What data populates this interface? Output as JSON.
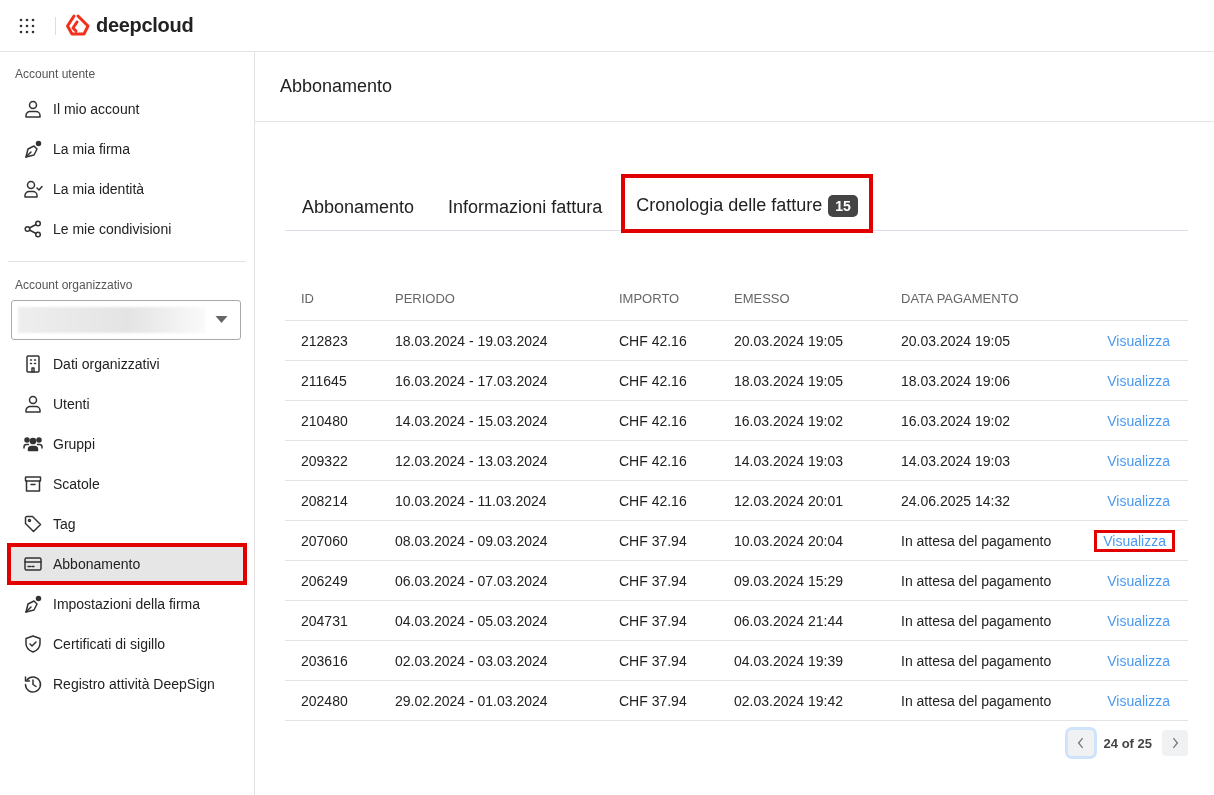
{
  "header": {
    "brand": "deepcloud"
  },
  "sidebar": {
    "sections": [
      {
        "label": "Account utente",
        "items": [
          {
            "label": "Il mio account",
            "selected": false,
            "highlighted": false
          },
          {
            "label": "La mia firma",
            "selected": false,
            "highlighted": false
          },
          {
            "label": "La mia identità",
            "selected": false,
            "highlighted": false
          },
          {
            "label": "Le mie condivisioni",
            "selected": false,
            "highlighted": false
          }
        ]
      },
      {
        "label": "Account organizzativo",
        "has_select": true,
        "items": [
          {
            "label": "Dati organizzativi",
            "selected": false,
            "highlighted": false
          },
          {
            "label": "Utenti",
            "selected": false,
            "highlighted": false
          },
          {
            "label": "Gruppi",
            "selected": false,
            "highlighted": false
          },
          {
            "label": "Scatole",
            "selected": false,
            "highlighted": false
          },
          {
            "label": "Tag",
            "selected": false,
            "highlighted": false
          },
          {
            "label": "Abbonamento",
            "selected": true,
            "highlighted": true
          },
          {
            "label": "Impostazioni della firma",
            "selected": false,
            "highlighted": false
          },
          {
            "label": "Certificati di sigillo",
            "selected": false,
            "highlighted": false
          },
          {
            "label": "Registro attività DeepSign",
            "selected": false,
            "highlighted": false
          }
        ]
      }
    ]
  },
  "page": {
    "title": "Abbonamento"
  },
  "tabs": [
    {
      "label": "Abbonamento",
      "selected": false,
      "highlighted": false
    },
    {
      "label": "Informazioni fattura",
      "selected": false,
      "highlighted": false
    },
    {
      "label": "Cronologia delle fatture",
      "badge": "15",
      "selected": true,
      "highlighted": true
    }
  ],
  "table": {
    "columns": [
      "ID",
      "PERIODO",
      "IMPORTO",
      "EMESSO",
      "DATA PAGAMENTO"
    ],
    "rows": [
      {
        "cells": [
          "212823",
          "18.03.2024 - 19.03.2024",
          "CHF 42.16",
          "20.03.2024 19:05",
          "20.03.2024 19:05"
        ],
        "link": "Visualizza",
        "highlighted": false
      },
      {
        "cells": [
          "211645",
          "16.03.2024 - 17.03.2024",
          "CHF 42.16",
          "18.03.2024 19:05",
          "18.03.2024 19:06"
        ],
        "link": "Visualizza",
        "highlighted": false
      },
      {
        "cells": [
          "210480",
          "14.03.2024 - 15.03.2024",
          "CHF 42.16",
          "16.03.2024 19:02",
          "16.03.2024 19:02"
        ],
        "link": "Visualizza",
        "highlighted": false
      },
      {
        "cells": [
          "209322",
          "12.03.2024 - 13.03.2024",
          "CHF 42.16",
          "14.03.2024 19:03",
          "14.03.2024 19:03"
        ],
        "link": "Visualizza",
        "highlighted": false
      },
      {
        "cells": [
          "208214",
          "10.03.2024 - 11.03.2024",
          "CHF 42.16",
          "12.03.2024 20:01",
          "24.06.2025 14:32"
        ],
        "link": "Visualizza",
        "highlighted": false
      },
      {
        "cells": [
          "207060",
          "08.03.2024 - 09.03.2024",
          "CHF 37.94",
          "10.03.2024 20:04",
          "In attesa del pagamento"
        ],
        "link": "Visualizza",
        "highlighted": true
      },
      {
        "cells": [
          "206249",
          "06.03.2024 - 07.03.2024",
          "CHF 37.94",
          "09.03.2024 15:29",
          "In attesa del pagamento"
        ],
        "link": "Visualizza",
        "highlighted": false
      },
      {
        "cells": [
          "204731",
          "04.03.2024 - 05.03.2024",
          "CHF 37.94",
          "06.03.2024 21:44",
          "In attesa del pagamento"
        ],
        "link": "Visualizza",
        "highlighted": false
      },
      {
        "cells": [
          "203616",
          "02.03.2024 - 03.03.2024",
          "CHF 37.94",
          "04.03.2024 19:39",
          "In attesa del pagamento"
        ],
        "link": "Visualizza",
        "highlighted": false
      },
      {
        "cells": [
          "202480",
          "29.02.2024 - 01.03.2024",
          "CHF 37.94",
          "02.03.2024 19:42",
          "In attesa del pagamento"
        ],
        "link": "Visualizza",
        "highlighted": false
      }
    ]
  },
  "pagination": {
    "label": "24 of 25",
    "prev": {
      "focused": true
    },
    "next": {
      "focused": false
    }
  }
}
